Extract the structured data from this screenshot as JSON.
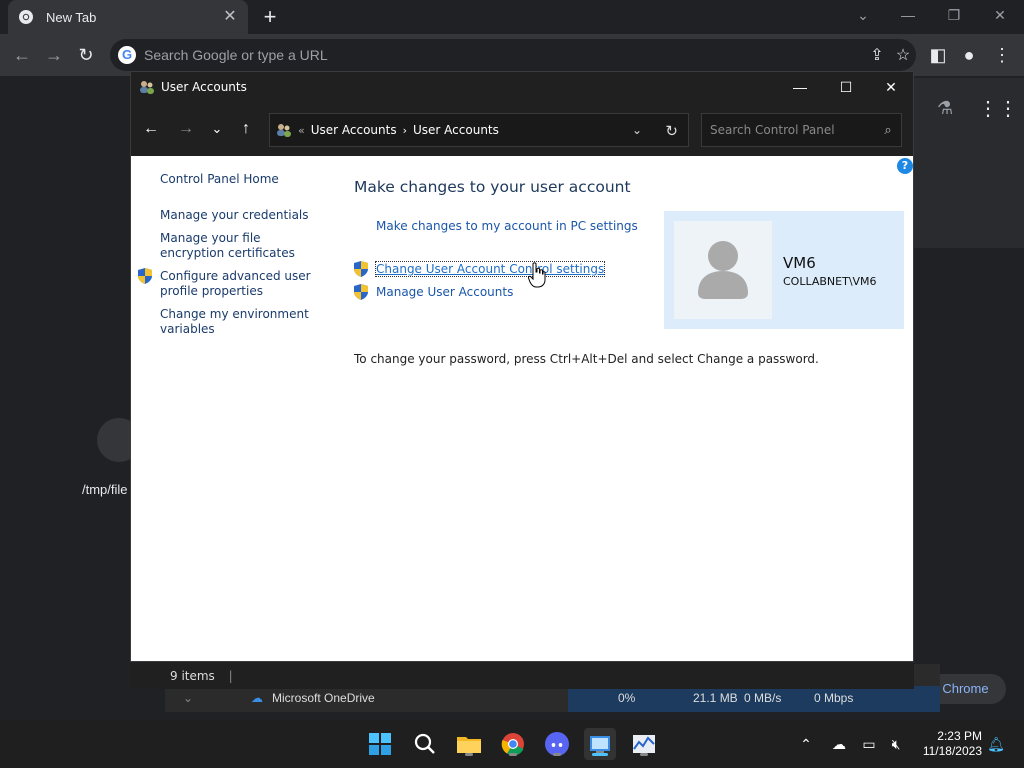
{
  "chrome": {
    "tab_title": "New Tab",
    "omnibox_placeholder": "Search Google or type a URL",
    "customize_label": "ze Chrome",
    "background_file_label": "/tmp/file"
  },
  "window": {
    "title": "User Accounts",
    "breadcrumb": [
      "User Accounts",
      "User Accounts"
    ],
    "search_placeholder": "Search Control Panel",
    "status_items": "9 items"
  },
  "left_nav": {
    "home": "Control Panel Home",
    "items": [
      "Manage your credentials",
      "Manage your file encryption certificates",
      "Configure advanced user profile properties",
      "Change my environment variables"
    ]
  },
  "main": {
    "title": "Make changes to your user account",
    "links": [
      "Make changes to my account in PC settings",
      "Change User Account Control settings",
      "Manage User Accounts"
    ],
    "password_note": "To change your password, press Ctrl+Alt+Del and select Change a password."
  },
  "user": {
    "name": "VM6",
    "domain": "COLLABNET\\VM6"
  },
  "task_manager_row": {
    "name": "Microsoft OneDrive",
    "cpu": "0%",
    "memory": "21.1 MB",
    "disk": "0 MB/s",
    "network": "0 Mbps"
  },
  "taskbar": {
    "time": "2:23 PM",
    "date": "11/18/2023"
  },
  "colors": {
    "link": "#1a56a8",
    "title": "#1e395b",
    "user_card": "#dcecfb",
    "taskbar_accent": "#4cc2ff"
  }
}
